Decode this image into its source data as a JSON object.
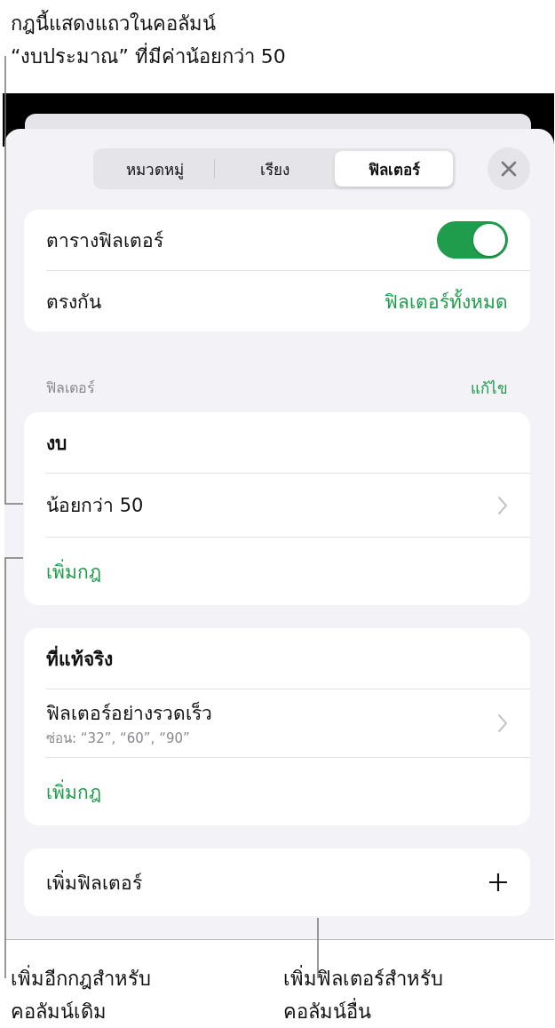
{
  "callouts_top": [
    {
      "text": "กฎนี้แสดงแถวในคอลัมน์\n“งบประมาณ” ที่มีค่าน้อยกว่า 50"
    }
  ],
  "tabs": [
    {
      "label": "หมวดหมู่",
      "selected": false
    },
    {
      "label": "เรียง",
      "selected": false
    },
    {
      "label": "ฟิลเตอร์",
      "selected": true
    }
  ],
  "settings": [
    {
      "kind": "toggle",
      "label": "ตารางฟิลเตอร์",
      "on": true
    },
    {
      "kind": "value",
      "label": "ตรงกัน",
      "value": "ฟิลเตอร์ทั้งหมด"
    }
  ],
  "section": {
    "title": "ฟิลเตอร์",
    "action": "แก้ไข"
  },
  "filters": [
    {
      "column": "งบ",
      "rules": [
        {
          "label": "น้อยกว่า 50"
        }
      ],
      "add_rule": "เพิ่มกฎ"
    },
    {
      "column": "ที่แท้จริง",
      "rules": [
        {
          "label": "ฟิลเตอร์อย่างรวดเร็ว",
          "detail": "ซ่อน: “32”, “60”, “90”"
        }
      ],
      "add_rule": "เพิ่มกฎ"
    }
  ],
  "add_filter": "เพิ่มฟิลเตอร์",
  "callouts_bottom": [
    {
      "text": "เพิ่มอีกกฎสำหรับ\nคอลัมน์เดิม"
    },
    {
      "text": "เพิ่มฟิลเตอร์สำหรับ\nคอลัมน์อื่น"
    }
  ]
}
